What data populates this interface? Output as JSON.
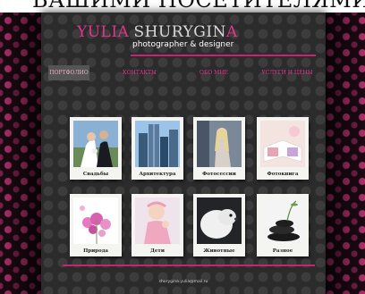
{
  "top_text": "ВАШИМИ ПОСЕТИТЕЛЯМИ РОЛЬ",
  "brand": {
    "first": "YULIA",
    "last_main": "SHURYGIN",
    "last_accent": "A",
    "tagline": "photographer & designer"
  },
  "nav": [
    {
      "label": "Портфолио",
      "active": true
    },
    {
      "label": "Контакты",
      "active": false
    },
    {
      "label": "Обо мне",
      "active": false
    },
    {
      "label": "Услуги и цены",
      "active": false
    }
  ],
  "gallery": [
    {
      "caption": "Свадьбы",
      "icon": "wedding-photo"
    },
    {
      "caption": "Архитектура",
      "icon": "architecture-photo"
    },
    {
      "caption": "Фотосессии",
      "icon": "photoshoot-photo"
    },
    {
      "caption": "Фотокнига",
      "icon": "photobook-photo"
    },
    {
      "caption": "Природа",
      "icon": "nature-photo"
    },
    {
      "caption": "Дети",
      "icon": "children-photo"
    },
    {
      "caption": "Животные",
      "icon": "animals-photo"
    },
    {
      "caption": "Разное",
      "icon": "misc-photo"
    }
  ],
  "footer": {
    "email": "shurygina.yulia@mail.ru"
  },
  "colors": {
    "accent": "#e0378a",
    "panel": "#2b2b2b"
  }
}
